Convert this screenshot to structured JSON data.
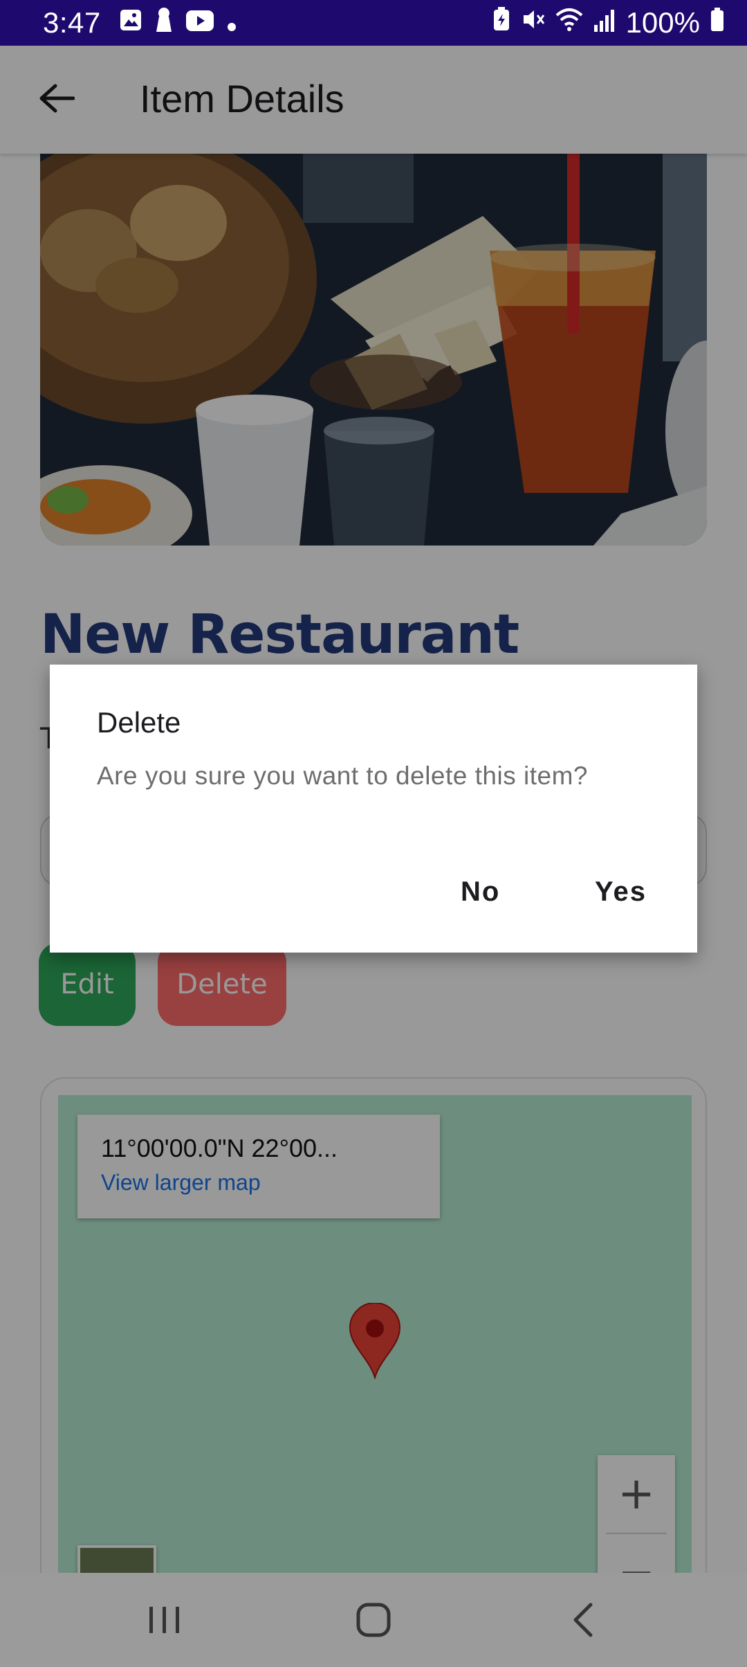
{
  "status_bar": {
    "time": "3:47",
    "battery": "100%",
    "background_color": "#1e0a6e"
  },
  "app_bar": {
    "title": "Item Details",
    "back_icon": "arrow-left-icon"
  },
  "item": {
    "title": "New Restaurant",
    "title_color": "#243a7a",
    "type_label_partial": "T"
  },
  "actions": {
    "edit_label": "Edit",
    "delete_label": "Delete",
    "edit_color": "#2ea85a",
    "delete_color": "#ff6b6b"
  },
  "map": {
    "coordinates": "11°00'00.0\"N 22°00...",
    "view_larger_label": "View larger map",
    "zoom_in_label": "+",
    "zoom_out_label": "−"
  },
  "dialog": {
    "title": "Delete",
    "message": "Are you sure you want to delete this item?",
    "no_label": "No",
    "yes_label": "Yes"
  },
  "nav_bar": {
    "recent_icon": "recent-apps-icon",
    "home_icon": "home-icon",
    "back_icon": "back-icon"
  }
}
